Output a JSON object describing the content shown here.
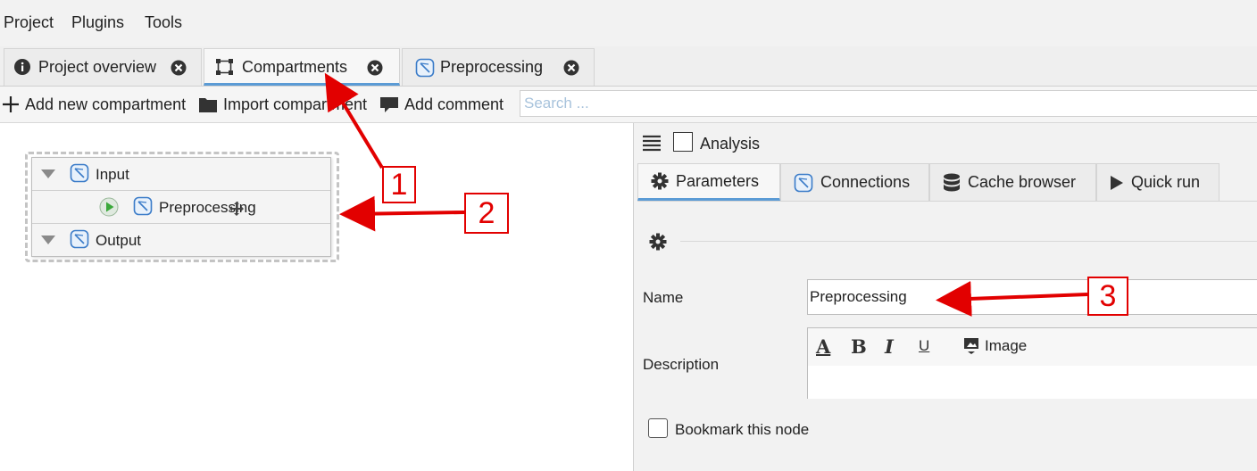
{
  "menu": {
    "items": [
      {
        "label": "Project"
      },
      {
        "label": "Plugins"
      },
      {
        "label": "Tools"
      }
    ]
  },
  "tabs": [
    {
      "label": "Project overview",
      "icon": "info-icon",
      "active": false
    },
    {
      "label": "Compartments",
      "icon": "compartments-icon",
      "active": true
    },
    {
      "label": "Preprocessing",
      "icon": "compartment-node-icon",
      "active": false
    }
  ],
  "toolbar": {
    "add_compartment": "Add new compartment",
    "import_compartment": "Import compartment",
    "add_comment": "Add comment",
    "search_placeholder": "Search ..."
  },
  "graph": {
    "compartment": {
      "input_label": "Input",
      "node_label": "Preprocessing",
      "output_label": "Output"
    }
  },
  "right_panel": {
    "analysis_label": "Analysis",
    "analysis_checked": false,
    "tabs": [
      {
        "label": "Parameters",
        "icon": "gear-icon",
        "active": true
      },
      {
        "label": "Connections",
        "icon": "compartment-node-icon",
        "active": false
      },
      {
        "label": "Cache browser",
        "icon": "database-icon",
        "active": false
      },
      {
        "label": "Quick run",
        "icon": "play-icon",
        "active": false
      }
    ],
    "name_label": "Name",
    "name_value": "Preprocessing",
    "description_label": "Description",
    "editor": {
      "bold": "B",
      "italic": "I",
      "underline": "U",
      "font_color": "A",
      "image_label": "Image"
    },
    "bookmark_label": "Bookmark this node",
    "bookmark_checked": false
  },
  "annotations": [
    {
      "number": "1"
    },
    {
      "number": "2"
    },
    {
      "number": "3"
    }
  ],
  "colors": {
    "annotation": "#e20000",
    "active_tab_underline": "#5b9bd5",
    "node_icon": "#3a7bc8",
    "run_green": "#3aa83a"
  }
}
